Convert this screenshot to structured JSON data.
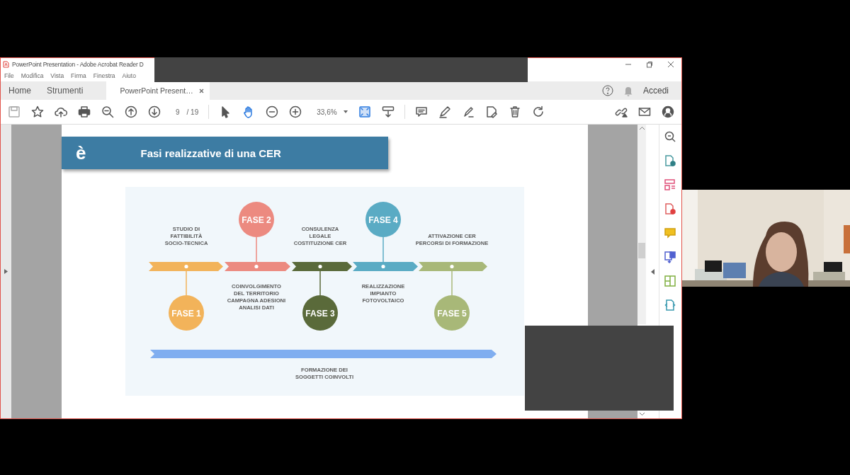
{
  "window": {
    "title": "PowerPoint Presentation - Adobe Acrobat Reader D"
  },
  "menu": [
    "File",
    "Modifica",
    "Vista",
    "Firma",
    "Finestra",
    "Aiuto"
  ],
  "tabs": [
    {
      "label": "Home",
      "selected": false
    },
    {
      "label": "Strumenti",
      "selected": false
    },
    {
      "label": "PowerPoint Present…",
      "selected": true
    }
  ],
  "account": {
    "label": "Accedi"
  },
  "toolbar": {
    "page": "9",
    "page_total": "/ 19",
    "zoom": "33,6%",
    "tools": [
      {
        "kind": "select",
        "selected": false
      },
      {
        "kind": "hand",
        "selected": true
      }
    ]
  },
  "slide": {
    "marker": "è",
    "title": "Fasi realizzative di una CER",
    "diagram": {
      "phases": [
        {
          "label": "FASE 1",
          "color": "#f2b35a",
          "kind": "lower",
          "description": [
            "STUDIO DI",
            "FATTIBILITÀ",
            "SOCIO-TECNICA"
          ]
        },
        {
          "label": "FASE 2",
          "color": "#ec8a80",
          "kind": "upper",
          "description": [
            "COINVOLGIMENTO",
            "DEL TERRITORIO",
            "CAMPAGNA ADESIONI",
            "ANALISI DATI"
          ]
        },
        {
          "label": "FASE 3",
          "color": "#5a6a3a",
          "kind": "lower",
          "description": [
            "CONSULENZA",
            "LEGALE",
            "COSTITUZIONE CER"
          ]
        },
        {
          "label": "FASE 4",
          "color": "#5aabc4",
          "kind": "upper",
          "description": [
            "REALIZZAZIONE",
            "IMPIANTO",
            "FOTOVOLTAICO"
          ]
        },
        {
          "label": "FASE 5",
          "color": "#a8b878",
          "kind": "lower",
          "description": [
            "ATTIVAZIONE CER",
            "PERCORSI DI FORMAZIONE"
          ]
        }
      ],
      "training": {
        "color": "#80aef0",
        "description": [
          "FORMAZIONE DEI",
          "SOGGETTI COINVOLTI"
        ]
      }
    }
  }
}
